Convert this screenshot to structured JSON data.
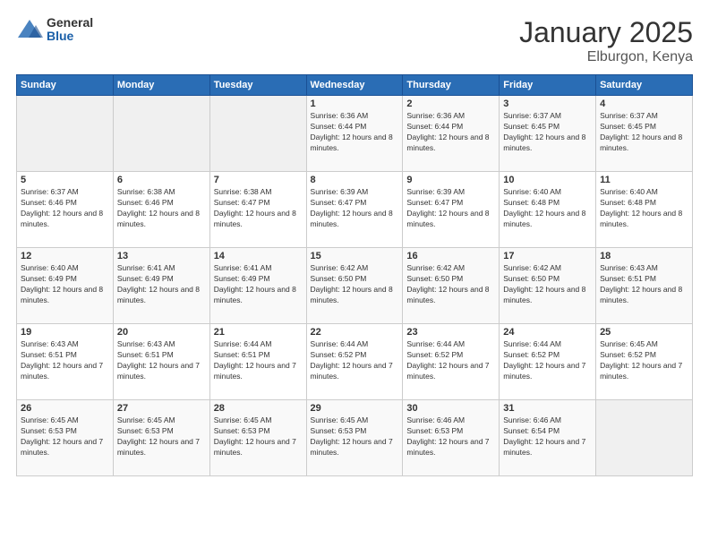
{
  "logo": {
    "general": "General",
    "blue": "Blue"
  },
  "title": {
    "month": "January 2025",
    "location": "Elburgon, Kenya"
  },
  "weekdays": [
    "Sunday",
    "Monday",
    "Tuesday",
    "Wednesday",
    "Thursday",
    "Friday",
    "Saturday"
  ],
  "weeks": [
    [
      {
        "day": "",
        "sunrise": "",
        "sunset": "",
        "daylight": ""
      },
      {
        "day": "",
        "sunrise": "",
        "sunset": "",
        "daylight": ""
      },
      {
        "day": "",
        "sunrise": "",
        "sunset": "",
        "daylight": ""
      },
      {
        "day": "1",
        "sunrise": "Sunrise: 6:36 AM",
        "sunset": "Sunset: 6:44 PM",
        "daylight": "Daylight: 12 hours and 8 minutes."
      },
      {
        "day": "2",
        "sunrise": "Sunrise: 6:36 AM",
        "sunset": "Sunset: 6:44 PM",
        "daylight": "Daylight: 12 hours and 8 minutes."
      },
      {
        "day": "3",
        "sunrise": "Sunrise: 6:37 AM",
        "sunset": "Sunset: 6:45 PM",
        "daylight": "Daylight: 12 hours and 8 minutes."
      },
      {
        "day": "4",
        "sunrise": "Sunrise: 6:37 AM",
        "sunset": "Sunset: 6:45 PM",
        "daylight": "Daylight: 12 hours and 8 minutes."
      }
    ],
    [
      {
        "day": "5",
        "sunrise": "Sunrise: 6:37 AM",
        "sunset": "Sunset: 6:46 PM",
        "daylight": "Daylight: 12 hours and 8 minutes."
      },
      {
        "day": "6",
        "sunrise": "Sunrise: 6:38 AM",
        "sunset": "Sunset: 6:46 PM",
        "daylight": "Daylight: 12 hours and 8 minutes."
      },
      {
        "day": "7",
        "sunrise": "Sunrise: 6:38 AM",
        "sunset": "Sunset: 6:47 PM",
        "daylight": "Daylight: 12 hours and 8 minutes."
      },
      {
        "day": "8",
        "sunrise": "Sunrise: 6:39 AM",
        "sunset": "Sunset: 6:47 PM",
        "daylight": "Daylight: 12 hours and 8 minutes."
      },
      {
        "day": "9",
        "sunrise": "Sunrise: 6:39 AM",
        "sunset": "Sunset: 6:47 PM",
        "daylight": "Daylight: 12 hours and 8 minutes."
      },
      {
        "day": "10",
        "sunrise": "Sunrise: 6:40 AM",
        "sunset": "Sunset: 6:48 PM",
        "daylight": "Daylight: 12 hours and 8 minutes."
      },
      {
        "day": "11",
        "sunrise": "Sunrise: 6:40 AM",
        "sunset": "Sunset: 6:48 PM",
        "daylight": "Daylight: 12 hours and 8 minutes."
      }
    ],
    [
      {
        "day": "12",
        "sunrise": "Sunrise: 6:40 AM",
        "sunset": "Sunset: 6:49 PM",
        "daylight": "Daylight: 12 hours and 8 minutes."
      },
      {
        "day": "13",
        "sunrise": "Sunrise: 6:41 AM",
        "sunset": "Sunset: 6:49 PM",
        "daylight": "Daylight: 12 hours and 8 minutes."
      },
      {
        "day": "14",
        "sunrise": "Sunrise: 6:41 AM",
        "sunset": "Sunset: 6:49 PM",
        "daylight": "Daylight: 12 hours and 8 minutes."
      },
      {
        "day": "15",
        "sunrise": "Sunrise: 6:42 AM",
        "sunset": "Sunset: 6:50 PM",
        "daylight": "Daylight: 12 hours and 8 minutes."
      },
      {
        "day": "16",
        "sunrise": "Sunrise: 6:42 AM",
        "sunset": "Sunset: 6:50 PM",
        "daylight": "Daylight: 12 hours and 8 minutes."
      },
      {
        "day": "17",
        "sunrise": "Sunrise: 6:42 AM",
        "sunset": "Sunset: 6:50 PM",
        "daylight": "Daylight: 12 hours and 8 minutes."
      },
      {
        "day": "18",
        "sunrise": "Sunrise: 6:43 AM",
        "sunset": "Sunset: 6:51 PM",
        "daylight": "Daylight: 12 hours and 8 minutes."
      }
    ],
    [
      {
        "day": "19",
        "sunrise": "Sunrise: 6:43 AM",
        "sunset": "Sunset: 6:51 PM",
        "daylight": "Daylight: 12 hours and 7 minutes."
      },
      {
        "day": "20",
        "sunrise": "Sunrise: 6:43 AM",
        "sunset": "Sunset: 6:51 PM",
        "daylight": "Daylight: 12 hours and 7 minutes."
      },
      {
        "day": "21",
        "sunrise": "Sunrise: 6:44 AM",
        "sunset": "Sunset: 6:51 PM",
        "daylight": "Daylight: 12 hours and 7 minutes."
      },
      {
        "day": "22",
        "sunrise": "Sunrise: 6:44 AM",
        "sunset": "Sunset: 6:52 PM",
        "daylight": "Daylight: 12 hours and 7 minutes."
      },
      {
        "day": "23",
        "sunrise": "Sunrise: 6:44 AM",
        "sunset": "Sunset: 6:52 PM",
        "daylight": "Daylight: 12 hours and 7 minutes."
      },
      {
        "day": "24",
        "sunrise": "Sunrise: 6:44 AM",
        "sunset": "Sunset: 6:52 PM",
        "daylight": "Daylight: 12 hours and 7 minutes."
      },
      {
        "day": "25",
        "sunrise": "Sunrise: 6:45 AM",
        "sunset": "Sunset: 6:52 PM",
        "daylight": "Daylight: 12 hours and 7 minutes."
      }
    ],
    [
      {
        "day": "26",
        "sunrise": "Sunrise: 6:45 AM",
        "sunset": "Sunset: 6:53 PM",
        "daylight": "Daylight: 12 hours and 7 minutes."
      },
      {
        "day": "27",
        "sunrise": "Sunrise: 6:45 AM",
        "sunset": "Sunset: 6:53 PM",
        "daylight": "Daylight: 12 hours and 7 minutes."
      },
      {
        "day": "28",
        "sunrise": "Sunrise: 6:45 AM",
        "sunset": "Sunset: 6:53 PM",
        "daylight": "Daylight: 12 hours and 7 minutes."
      },
      {
        "day": "29",
        "sunrise": "Sunrise: 6:45 AM",
        "sunset": "Sunset: 6:53 PM",
        "daylight": "Daylight: 12 hours and 7 minutes."
      },
      {
        "day": "30",
        "sunrise": "Sunrise: 6:46 AM",
        "sunset": "Sunset: 6:53 PM",
        "daylight": "Daylight: 12 hours and 7 minutes."
      },
      {
        "day": "31",
        "sunrise": "Sunrise: 6:46 AM",
        "sunset": "Sunset: 6:54 PM",
        "daylight": "Daylight: 12 hours and 7 minutes."
      },
      {
        "day": "",
        "sunrise": "",
        "sunset": "",
        "daylight": ""
      }
    ]
  ]
}
